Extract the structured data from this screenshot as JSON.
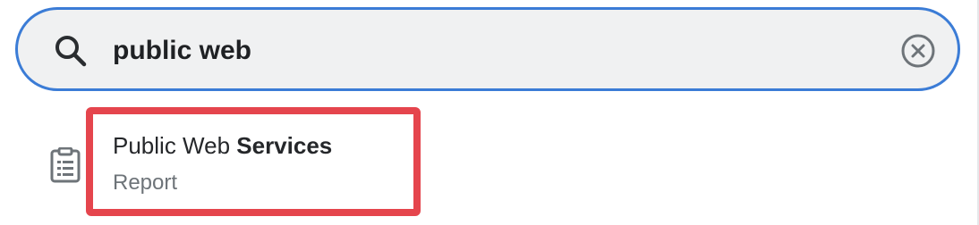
{
  "search": {
    "query": "public web",
    "search_icon": "search-icon",
    "clear_icon": "close-circle-icon"
  },
  "results": [
    {
      "icon": "report-clipboard-icon",
      "title_match": "Public Web",
      "title_rest": "Services",
      "type": "Report"
    }
  ],
  "colors": {
    "focus_border": "#3b7cd6",
    "highlight_border": "#e5454d",
    "search_background": "#f0f1f2",
    "icon_gray": "#6e7479",
    "text_dark": "#25272a"
  }
}
